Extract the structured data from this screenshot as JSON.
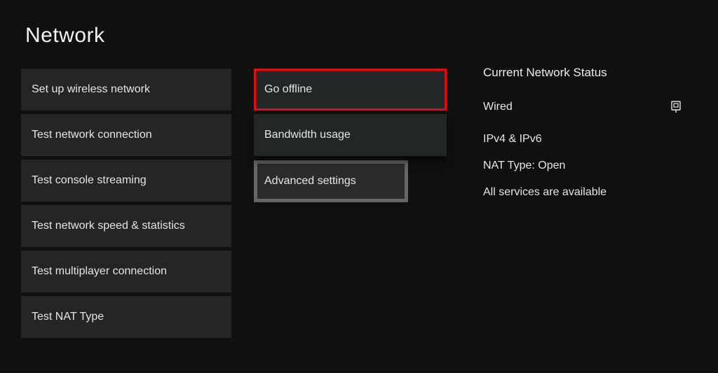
{
  "title": "Network",
  "col1": {
    "items": [
      "Set up wireless network",
      "Test network connection",
      "Test console streaming",
      "Test network speed & statistics",
      "Test multiplayer connection",
      "Test NAT Type"
    ]
  },
  "col2": {
    "items": [
      "Go offline",
      "Bandwidth usage",
      "Advanced settings"
    ]
  },
  "status": {
    "heading": "Current Network Status",
    "connection": "Wired",
    "ipinfo": "IPv4 & IPv6",
    "nat": "NAT Type: Open",
    "services": "All services are available"
  }
}
